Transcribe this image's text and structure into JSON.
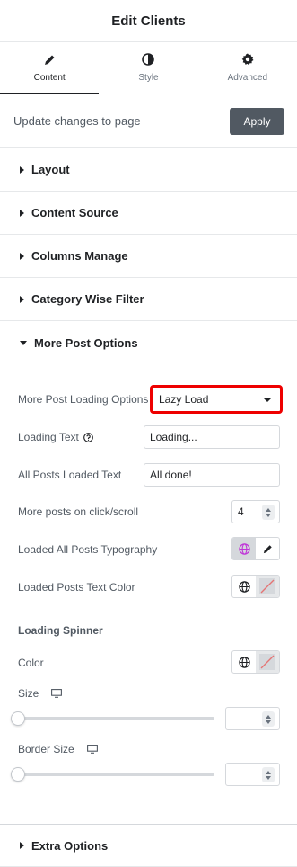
{
  "header": {
    "title": "Edit Clients"
  },
  "tabs": [
    {
      "label": "Content",
      "icon": "pencil-icon",
      "active": true
    },
    {
      "label": "Style",
      "icon": "half-circle-icon",
      "active": false
    },
    {
      "label": "Advanced",
      "icon": "gear-icon",
      "active": false
    }
  ],
  "update": {
    "text": "Update changes to page",
    "apply_label": "Apply"
  },
  "sections": {
    "layout": "Layout",
    "content_source": "Content Source",
    "columns_manage": "Columns Manage",
    "category_filter": "Category Wise Filter",
    "more_post_options": "More Post Options",
    "extra_options": "Extra Options"
  },
  "more_post": {
    "loading_options_label": "More Post Loading Options",
    "loading_options_value": "Lazy Load",
    "loading_text_label": "Loading Text",
    "loading_text_value": "Loading...",
    "all_loaded_label": "All Posts Loaded Text",
    "all_loaded_value": "All done!",
    "more_posts_label": "More posts on click/scroll",
    "more_posts_value": "4",
    "typography_label": "Loaded All Posts Typography",
    "text_color_label": "Loaded Posts Text Color"
  },
  "spinner": {
    "heading": "Loading Spinner",
    "color_label": "Color",
    "size_label": "Size",
    "border_size_label": "Border Size",
    "size_value": 0,
    "border_size_value": 0
  },
  "colors": {
    "highlight": "#e00000",
    "apply_bg": "#515962",
    "globe_active": "#c036d8"
  }
}
